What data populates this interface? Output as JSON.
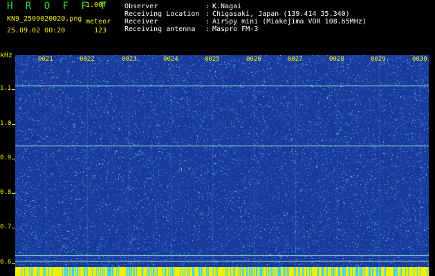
{
  "header": {
    "app_title": "H R O F F T",
    "version": "1.00f",
    "filename": "KN9_2509020020.png",
    "mode": "meteor",
    "datetime": "25.09.02 00:20",
    "count": "123"
  },
  "info": [
    {
      "key": "Observer",
      "sep": ":",
      "value": "K.Nagai"
    },
    {
      "key": "Receiving Location",
      "sep": ":",
      "value": "Chigasaki, Japan (139.414 35.340)"
    },
    {
      "key": "Receiver",
      "sep": ":",
      "value": "AirSpy mini (Miakejima VOR 108.65MHz)"
    },
    {
      "key": "Receiving antenna",
      "sep": ":",
      "value": "Maspro FM-3"
    }
  ],
  "spectrogram": {
    "unit": "kHz",
    "y_labels": [
      "1.1",
      "1.0",
      "0.9",
      "0.8",
      "0.7",
      "0.6"
    ],
    "x_labels": [
      "0021",
      "0022",
      "0023",
      "0024",
      "0025",
      "0026",
      "0027",
      "0028",
      "0029",
      "0030"
    ],
    "colors": {
      "background": "#1a3a9c",
      "noise_low": "#2f6cf0",
      "noise_mid": "#39c8e8",
      "noise_high": "#b7f7e6",
      "carrier": "#9af5d0",
      "label": "#f2f200",
      "bar_yellow": "#f0f000",
      "bar_cyan": "#30d0ff"
    }
  }
}
